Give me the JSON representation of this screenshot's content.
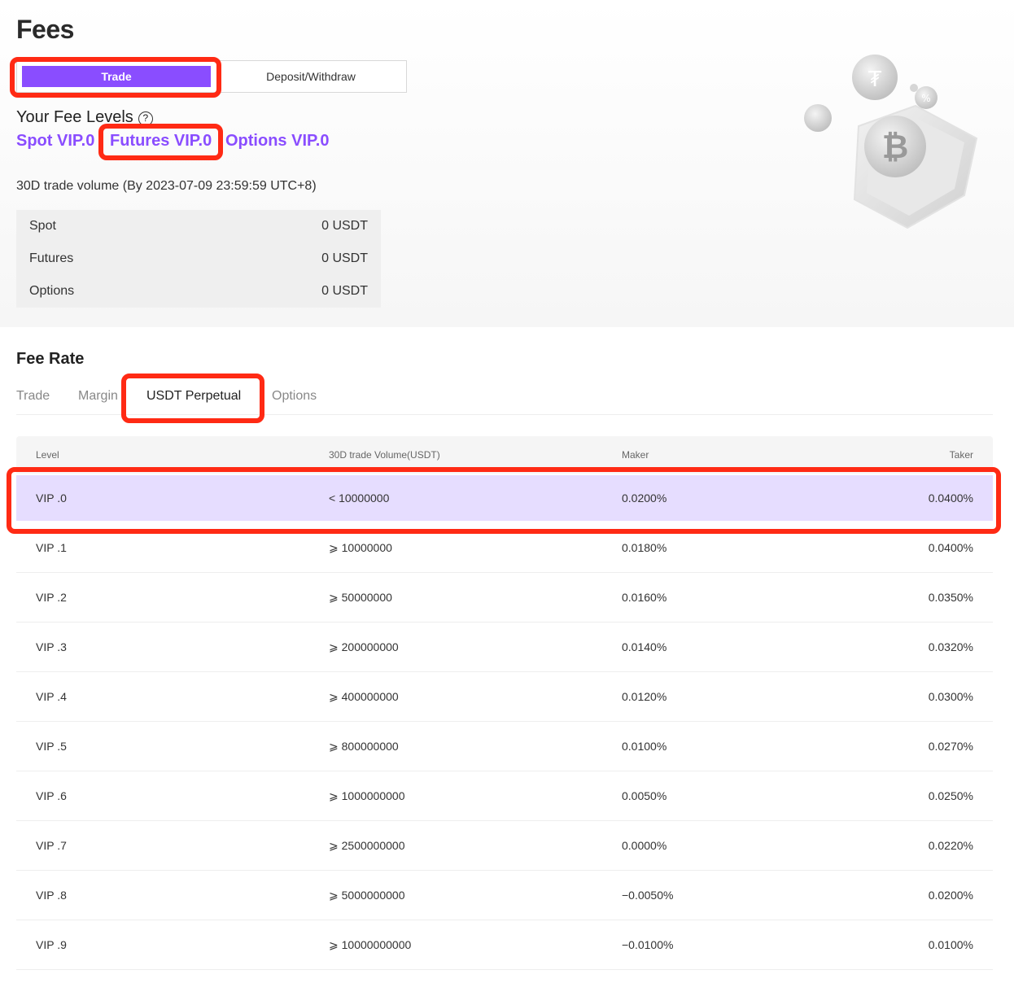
{
  "header": {
    "title": "Fees"
  },
  "mode_tabs": [
    {
      "label": "Trade",
      "active": true
    },
    {
      "label": "Deposit/Withdraw",
      "active": false
    }
  ],
  "fee_levels": {
    "title": "Your Fee Levels",
    "help_icon": "question-circle-icon",
    "spot": "Spot VIP.0",
    "futures": "Futures VIP.0",
    "options": "Options VIP.0"
  },
  "volume": {
    "caption": "30D trade volume (By 2023-07-09 23:59:59 UTC+8)",
    "rows": [
      {
        "label": "Spot",
        "value": "0 USDT"
      },
      {
        "label": "Futures",
        "value": "0 USDT"
      },
      {
        "label": "Options",
        "value": "0 USDT"
      }
    ]
  },
  "fee_rate": {
    "title": "Fee Rate",
    "tabs": [
      {
        "label": "Trade",
        "active": false
      },
      {
        "label": "Margin",
        "active": false
      },
      {
        "label": "USDT Perpetual",
        "active": true
      },
      {
        "label": "Options",
        "active": false
      }
    ],
    "columns": [
      "Level",
      "30D trade Volume(USDT)",
      "Maker",
      "Taker"
    ],
    "rows": [
      {
        "level": "VIP .0",
        "volume": "< 10000000",
        "maker": "0.0200%",
        "taker": "0.0400%",
        "current": true
      },
      {
        "level": "VIP .1",
        "volume": "⩾ 10000000",
        "maker": "0.0180%",
        "taker": "0.0400%"
      },
      {
        "level": "VIP .2",
        "volume": "⩾ 50000000",
        "maker": "0.0160%",
        "taker": "0.0350%"
      },
      {
        "level": "VIP .3",
        "volume": "⩾ 200000000",
        "maker": "0.0140%",
        "taker": "0.0320%"
      },
      {
        "level": "VIP .4",
        "volume": "⩾ 400000000",
        "maker": "0.0120%",
        "taker": "0.0300%"
      },
      {
        "level": "VIP .5",
        "volume": "⩾ 800000000",
        "maker": "0.0100%",
        "taker": "0.0270%"
      },
      {
        "level": "VIP .6",
        "volume": "⩾ 1000000000",
        "maker": "0.0050%",
        "taker": "0.0250%"
      },
      {
        "level": "VIP .7",
        "volume": "⩾ 2500000000",
        "maker": "0.0000%",
        "taker": "0.0220%"
      },
      {
        "level": "VIP .8",
        "volume": "⩾ 5000000000",
        "maker": "−0.0050%",
        "taker": "0.0200%"
      },
      {
        "level": "VIP .9",
        "volume": "⩾ 10000000000",
        "maker": "−0.0100%",
        "taker": "0.0100%"
      }
    ]
  },
  "colors": {
    "accent": "#8a4dff",
    "highlight": "#ff2a14",
    "current_row": "#e6ddff"
  },
  "illustration": {
    "icon": "bitcoin-shield-illustration"
  }
}
